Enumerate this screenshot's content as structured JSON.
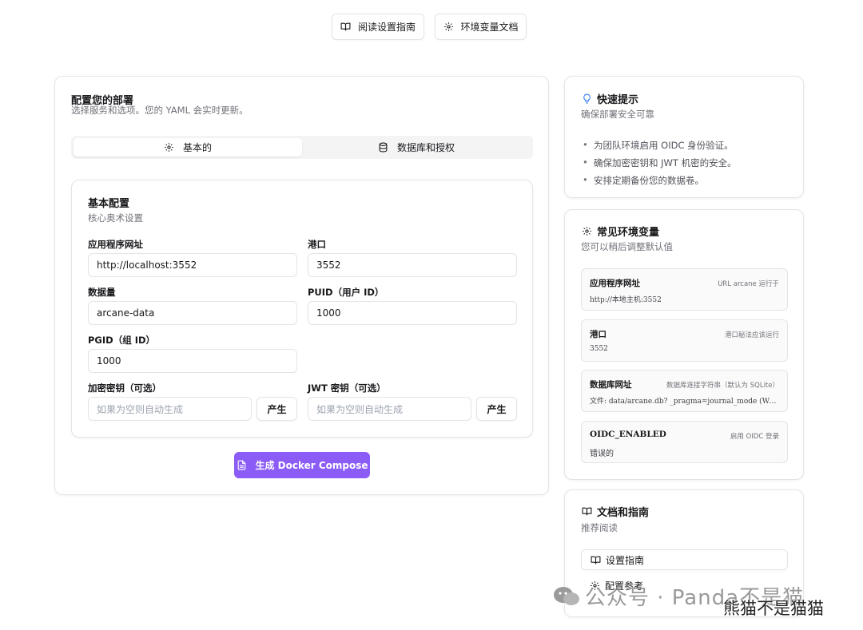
{
  "top_buttons": {
    "guide": "阅读设置指南",
    "env_docs": "环境变量文档"
  },
  "config": {
    "title": "配置您的部署",
    "subtitle": "选择服务和选项。您的 YAML 会实时更新。",
    "tabs": [
      {
        "label": "基本的",
        "icon": "gear-icon",
        "active": true
      },
      {
        "label": "数据库和授权",
        "icon": "database-icon",
        "active": false
      }
    ],
    "basic": {
      "title": "基本配置",
      "subtitle": "核心奥术设置",
      "app_url_label": "应用程序网址",
      "app_url_value": "http://localhost:3552",
      "port_label": "港口",
      "port_value": "3552",
      "data_label": "数据量",
      "data_value": "arcane-data",
      "puid_label": "PUID（用户 ID）",
      "puid_value": "1000",
      "pgid_label": "PGID（组 ID）",
      "pgid_value": "1000",
      "enc_label": "加密密钥（可选）",
      "enc_placeholder": "如果为空则自动生成",
      "enc_button": "产生",
      "jwt_label": "JWT 密钥（可选）",
      "jwt_placeholder": "如果为空则自动生成",
      "jwt_button": "产生"
    },
    "generate_button": "生成 Docker Compose"
  },
  "tips": {
    "title": "快速提示",
    "subtitle": "确保部署安全可靠",
    "items": [
      "为团队环境启用 OIDC 身份验证。",
      "确保加密密钥和 JWT 机密的安全。",
      "安排定期备份您的数据卷。"
    ]
  },
  "env": {
    "title": "常见环境变量",
    "subtitle": "您可以稍后调整默认值",
    "items": [
      {
        "name": "应用程序网址",
        "desc": "URL arcane 运行于",
        "value": "http://本地主机:3552"
      },
      {
        "name": "港口",
        "desc": "港口秘法应该运行",
        "value": "3552"
      },
      {
        "name": "数据库网址",
        "desc": "数据库连接字符串（默认为 SQLite）",
        "value": "文件: data/arcane.db? _pragma=journal_mode (WA…"
      },
      {
        "name": "OIDC_ENABLED",
        "desc": "启用 OIDC 登录",
        "value": "错误的"
      }
    ]
  },
  "docs": {
    "title": "文档和指南",
    "subtitle": "推荐阅读",
    "links": [
      "设置指南",
      "配置参考"
    ]
  },
  "watermark": {
    "line1": "公众号 · Panda不是猫",
    "line2": "熊猫不是猫猫"
  },
  "colors": {
    "accent": "#8b5cf6",
    "tip_icon": "#3b82f6"
  }
}
